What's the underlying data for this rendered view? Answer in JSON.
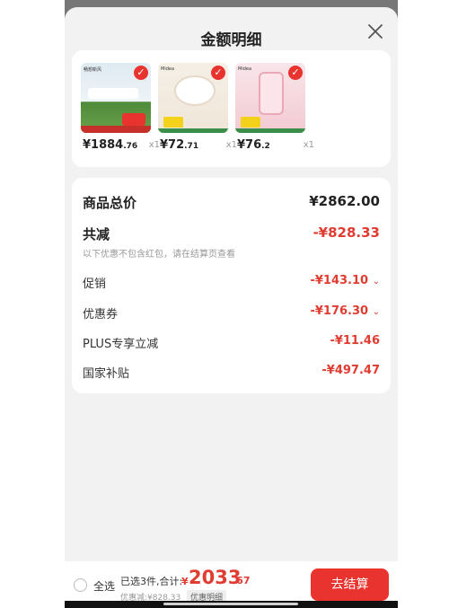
{
  "sheet": {
    "title": "金额明细"
  },
  "products": [
    {
      "image_tag": "畅想新风",
      "price_int": "¥1884",
      "price_dec": ".76",
      "qty": "x1",
      "image_colors": [
        "#e7f0f7",
        "#4f8a3a"
      ]
    },
    {
      "image_tag": "Midea",
      "price_int": "¥72",
      "price_dec": ".71",
      "qty": "x1",
      "image_colors": [
        "#f4eee4",
        "#e0d4c2"
      ]
    },
    {
      "image_tag": "Midea",
      "price_int": "¥76",
      "price_dec": ".2",
      "qty": "x1",
      "image_colors": [
        "#f7e3e6",
        "#f3b9c4"
      ]
    }
  ],
  "summary": {
    "total_label": "商品总价",
    "total_value": "¥2862.00",
    "reduce_label": "共减",
    "reduce_value": "-¥828.33",
    "note": "以下优惠不包含红包，请在结算页查看",
    "promo_label": "促销",
    "promo_value": "-¥143.10",
    "coupon_label": "优惠券",
    "coupon_value": "-¥176.30",
    "plus_label": "PLUS专享立减",
    "plus_value": "-¥11.46",
    "subsidy_label": "国家补贴",
    "subsidy_value": "-¥497.47",
    "caret": "⌄"
  },
  "bottom": {
    "select_all": "全选",
    "selected": "已选3件,合计:",
    "currency": "¥",
    "total_int": "2033",
    "total_dec": ".67",
    "discount": "优惠减:¥828.33",
    "detail_link": "优惠明细",
    "checkout": "去结算"
  },
  "colors": {
    "accent": "#e8332e",
    "discount_text": "#e03c31"
  }
}
